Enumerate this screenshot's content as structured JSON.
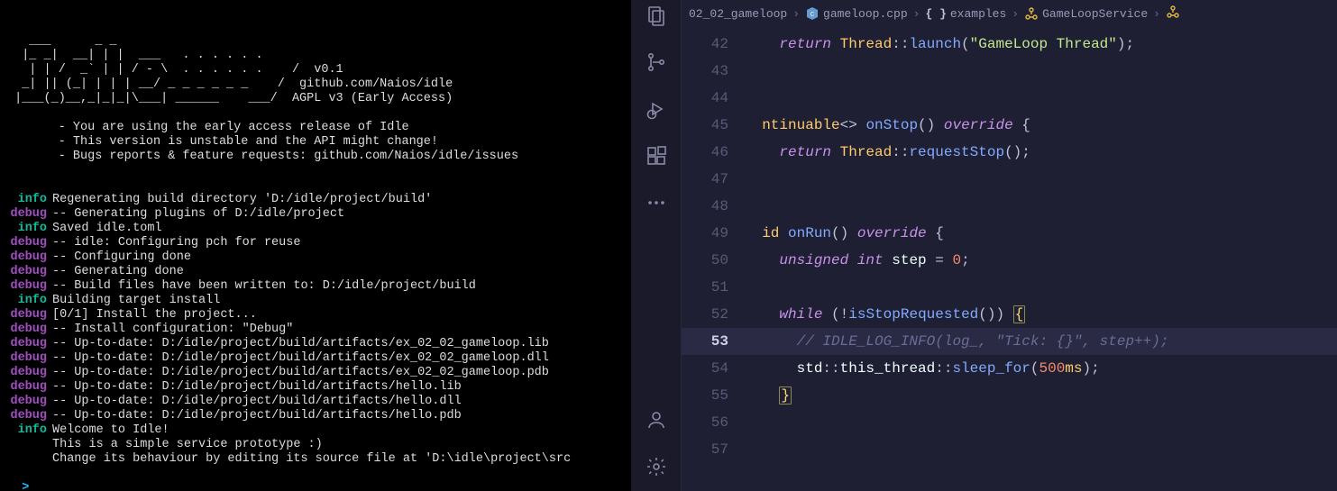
{
  "terminal": {
    "ascii": [
      "   ___      _ _   ",
      "  |_ _|  __| | |  ___   . . . . . .",
      "   | | /  _` | | / - \\  . . . . . .    /  v0.1",
      "  _| || (_| | | | __/ _ _ _ _ _ _    /  github.com/Naios/idle",
      " |___(_)__,_|_|_|\\___| ______    ___/  AGPL v3 (Early Access)",
      "",
      "       - You are using the early access release of Idle",
      "       - This version is unstable and the API might change!",
      "       - Bugs reports & feature requests: github.com/Naios/idle/issues",
      ""
    ],
    "lines": [
      {
        "level": "info",
        "msg": "Regenerating build directory 'D:/idle/project/build'"
      },
      {
        "level": "debug",
        "msg": "-- Generating plugins of D:/idle/project"
      },
      {
        "level": "info",
        "msg": "Saved idle.toml"
      },
      {
        "level": "debug",
        "msg": "-- idle: Configuring pch for reuse"
      },
      {
        "level": "debug",
        "msg": "-- Configuring done"
      },
      {
        "level": "debug",
        "msg": "-- Generating done"
      },
      {
        "level": "debug",
        "msg": "-- Build files have been written to: D:/idle/project/build"
      },
      {
        "level": "info",
        "msg": "Building target install"
      },
      {
        "level": "debug",
        "msg": "[0/1] Install the project..."
      },
      {
        "level": "debug",
        "msg": "-- Install configuration: \"Debug\""
      },
      {
        "level": "debug",
        "msg": "-- Up-to-date: D:/idle/project/build/artifacts/ex_02_02_gameloop.lib"
      },
      {
        "level": "debug",
        "msg": "-- Up-to-date: D:/idle/project/build/artifacts/ex_02_02_gameloop.dll"
      },
      {
        "level": "debug",
        "msg": "-- Up-to-date: D:/idle/project/build/artifacts/ex_02_02_gameloop.pdb"
      },
      {
        "level": "debug",
        "msg": "-- Up-to-date: D:/idle/project/build/artifacts/hello.lib"
      },
      {
        "level": "debug",
        "msg": "-- Up-to-date: D:/idle/project/build/artifacts/hello.dll"
      },
      {
        "level": "debug",
        "msg": "-- Up-to-date: D:/idle/project/build/artifacts/hello.pdb"
      },
      {
        "level": "info",
        "msg": "Welcome to Idle!"
      },
      {
        "level": "",
        "msg": "This is a simple service prototype :)"
      },
      {
        "level": "",
        "msg": "Change its behaviour by editing its source file at 'D:\\idle\\project\\src"
      }
    ],
    "prompt": ">"
  },
  "breadcrumb": {
    "parts": [
      {
        "icon": null,
        "text": "02_02_gameloop"
      },
      {
        "icon": "cpp",
        "text": "gameloop.cpp"
      },
      {
        "icon": "braces",
        "text": "examples"
      },
      {
        "icon": "class",
        "text": "GameLoopService"
      }
    ]
  },
  "code": {
    "current_line": 53,
    "lines": [
      {
        "n": 42,
        "tokens": [
          [
            "",
            "    "
          ],
          [
            "ctl",
            "return"
          ],
          [
            "",
            " "
          ],
          [
            "ty",
            "Thread"
          ],
          [
            "pun",
            "::"
          ],
          [
            "fn",
            "launch"
          ],
          [
            "pun",
            "("
          ],
          [
            "str",
            "\"GameLoop Thread\""
          ],
          [
            "pun",
            ");"
          ]
        ]
      },
      {
        "n": 43,
        "tokens": []
      },
      {
        "n": 44,
        "tokens": []
      },
      {
        "n": 45,
        "tokens": [
          [
            "",
            "  "
          ],
          [
            "ty",
            "ntinuable"
          ],
          [
            "pun",
            "<> "
          ],
          [
            "fn",
            "onStop"
          ],
          [
            "pun",
            "() "
          ],
          [
            "kw",
            "override"
          ],
          [
            "pun",
            " {"
          ]
        ]
      },
      {
        "n": 46,
        "tokens": [
          [
            "",
            "    "
          ],
          [
            "ctl",
            "return"
          ],
          [
            "",
            " "
          ],
          [
            "ty",
            "Thread"
          ],
          [
            "pun",
            "::"
          ],
          [
            "fn",
            "requestStop"
          ],
          [
            "pun",
            "();"
          ]
        ]
      },
      {
        "n": 47,
        "tokens": []
      },
      {
        "n": 48,
        "tokens": []
      },
      {
        "n": 49,
        "tokens": [
          [
            "",
            "  "
          ],
          [
            "ty",
            "id"
          ],
          [
            "",
            " "
          ],
          [
            "fn",
            "onRun"
          ],
          [
            "pun",
            "() "
          ],
          [
            "kw",
            "override"
          ],
          [
            "pun",
            " {"
          ]
        ]
      },
      {
        "n": 50,
        "tokens": [
          [
            "",
            "    "
          ],
          [
            "kw",
            "unsigned"
          ],
          [
            "",
            " "
          ],
          [
            "kw",
            "int"
          ],
          [
            "",
            " "
          ],
          [
            "var",
            "step"
          ],
          [
            "",
            " "
          ],
          [
            "pun",
            "="
          ],
          [
            "",
            " "
          ],
          [
            "num",
            "0"
          ],
          [
            "pun",
            ";"
          ]
        ]
      },
      {
        "n": 51,
        "tokens": []
      },
      {
        "n": 52,
        "tokens": [
          [
            "",
            "    "
          ],
          [
            "ctl",
            "while"
          ],
          [
            "",
            " "
          ],
          [
            "pun",
            "("
          ],
          [
            "pun",
            "!"
          ],
          [
            "fn",
            "isStopRequested"
          ],
          [
            "pun",
            "()"
          ],
          [
            "pun",
            ") "
          ],
          [
            "brk",
            "{"
          ]
        ]
      },
      {
        "n": 53,
        "tokens": [
          [
            "",
            "      "
          ],
          [
            "com",
            "// IDLE_LOG_INFO(log_, \"Tick: {}\", step++);"
          ]
        ]
      },
      {
        "n": 54,
        "tokens": [
          [
            "",
            "      "
          ],
          [
            "var",
            "std"
          ],
          [
            "pun",
            "::"
          ],
          [
            "var",
            "this_thread"
          ],
          [
            "pun",
            "::"
          ],
          [
            "fn",
            "sleep_for"
          ],
          [
            "pun",
            "("
          ],
          [
            "num",
            "500"
          ],
          [
            "ty",
            "ms"
          ],
          [
            "pun",
            ");"
          ]
        ]
      },
      {
        "n": 55,
        "tokens": [
          [
            "",
            "    "
          ],
          [
            "brk",
            "}"
          ]
        ]
      },
      {
        "n": 56,
        "tokens": []
      },
      {
        "n": 57,
        "tokens": []
      }
    ]
  },
  "icons": {
    "explorer": "explorer-icon",
    "scm": "source-control-icon",
    "debug": "debug-icon",
    "extensions": "extensions-icon",
    "more": "more-icon",
    "account": "account-icon",
    "settings": "gear-icon"
  }
}
